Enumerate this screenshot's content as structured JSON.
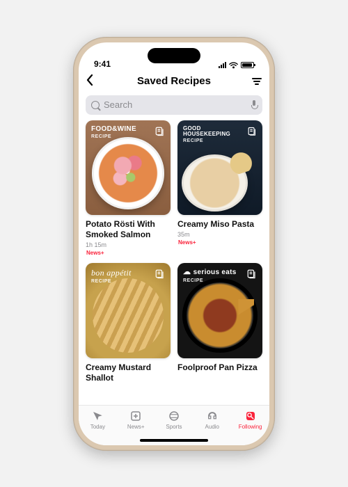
{
  "status_bar": {
    "time": "9:41"
  },
  "header": {
    "title": "Saved Recipes",
    "search_placeholder": "Search"
  },
  "recipes": [
    {
      "source": "FOOD&WINE",
      "tag": "RECIPE",
      "title": "Potato Rösti With Smoked Salmon",
      "meta": "1h 15m",
      "badge": "News+"
    },
    {
      "source": "GOOD HOUSEKEEPING",
      "tag": "RECIPE",
      "title": "Creamy Miso Pasta",
      "meta": "35m",
      "badge": "News+"
    },
    {
      "source": "bon appétit",
      "tag": "RECIPE",
      "title": "Creamy Mustard Shallot",
      "meta": "",
      "badge": ""
    },
    {
      "source": "serious eats",
      "tag": "RECIPE",
      "title": "Foolproof Pan Pizza",
      "meta": "",
      "badge": ""
    }
  ],
  "tabs": [
    {
      "label": "Today"
    },
    {
      "label": "News+"
    },
    {
      "label": "Sports"
    },
    {
      "label": "Audio"
    },
    {
      "label": "Following"
    }
  ]
}
